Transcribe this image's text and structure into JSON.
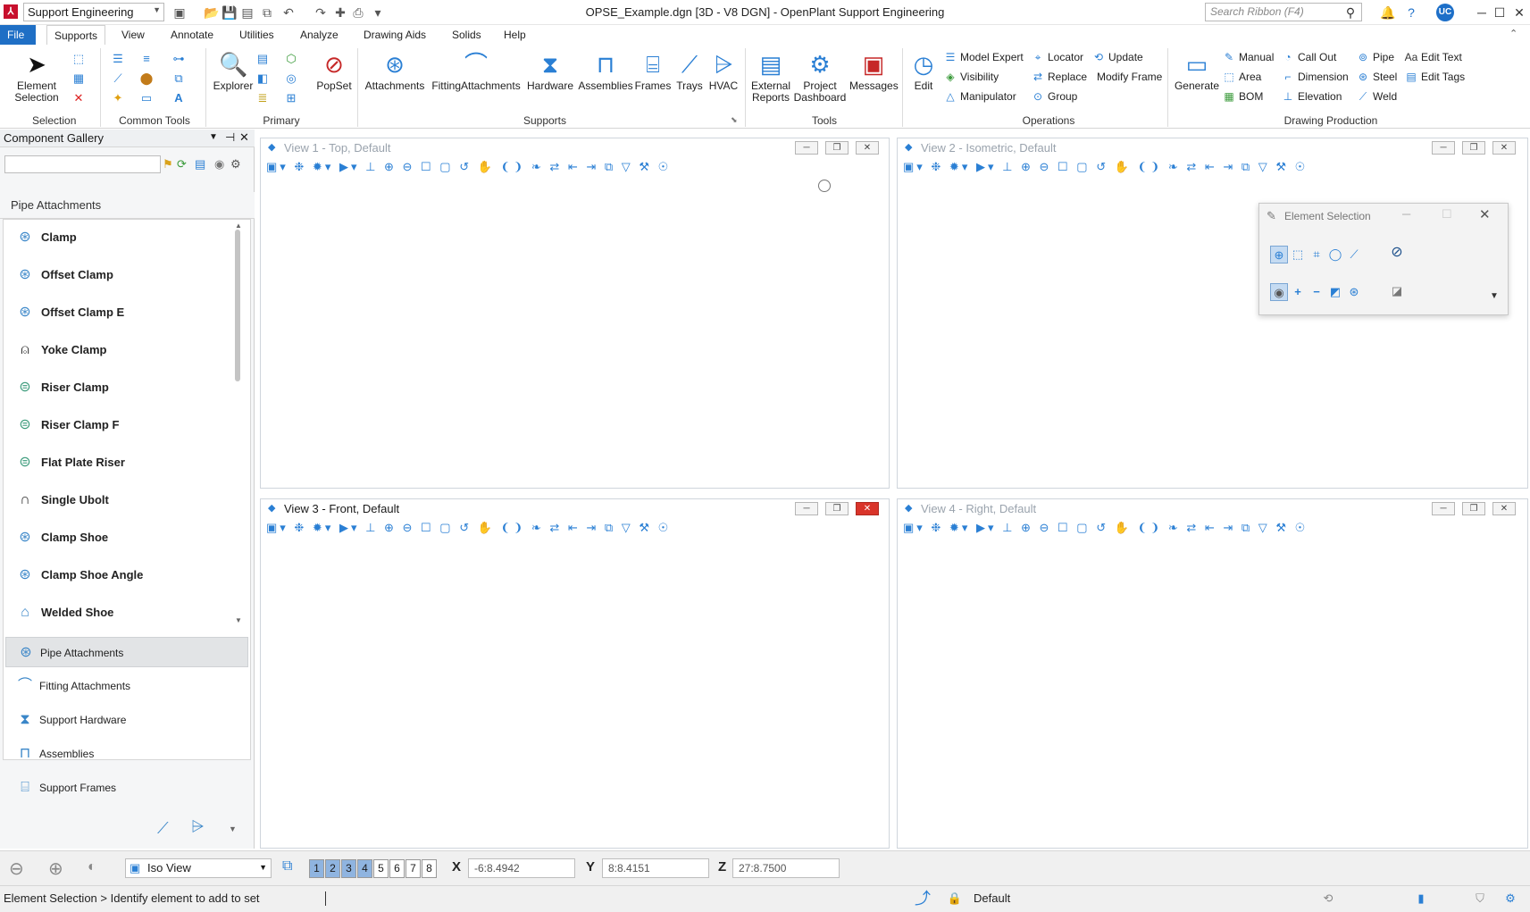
{
  "window": {
    "title": "OPSE_Example.dgn [3D - V8 DGN] - OpenPlant Support Engineering",
    "app_icon": "⅄",
    "workflow": "Support Engineering",
    "search_placeholder": "Search Ribbon (F4)",
    "user_initials": "UC"
  },
  "menu": {
    "tabs": [
      "File",
      "Supports",
      "View",
      "Annotate",
      "Utilities",
      "Analyze",
      "Drawing Aids",
      "Solids",
      "Help"
    ],
    "active_tab": "Supports"
  },
  "ribbon": {
    "groups": {
      "selection": "Selection",
      "common_tools": "Common Tools",
      "primary": "Primary",
      "supports": "Supports",
      "tools": "Tools",
      "operations": "Operations",
      "drawing_production": "Drawing Production"
    },
    "element_selection": "Element\nSelection",
    "element_selection_l1": "Element",
    "element_selection_l2": "Selection",
    "explorer": "Explorer",
    "popset": "PopSet",
    "attachments": "Attachments",
    "fitting_attachments": "FittingAttachments",
    "hardware": "Hardware",
    "assemblies": "Assemblies",
    "frames": "Frames",
    "trays": "Trays",
    "hvac": "HVAC",
    "external_reports_l1": "External",
    "external_reports_l2": "Reports",
    "project_dashboard_l1": "Project",
    "project_dashboard_l2": "Dashboard",
    "messages": "Messages",
    "edit": "Edit",
    "model_expert": "Model Expert",
    "visibility": "Visibility",
    "manipulator": "Manipulator",
    "locator": "Locator",
    "replace": "Replace",
    "group": "Group",
    "update": "Update",
    "modify_frame": "Modify Frame",
    "generate": "Generate",
    "manual": "Manual",
    "area": "Area",
    "bom": "BOM",
    "call_out": "Call Out",
    "dimension": "Dimension",
    "elevation": "Elevation",
    "pipe": "Pipe",
    "steel": "Steel",
    "weld": "Weld",
    "edit_text": "Edit Text",
    "edit_tags": "Edit Tags"
  },
  "gallery": {
    "title": "Component Gallery",
    "category": "Pipe Attachments",
    "items": [
      {
        "label": "Clamp",
        "icon": "clamp-icon"
      },
      {
        "label": "Offset Clamp",
        "icon": "offset-clamp-icon"
      },
      {
        "label": "Offset Clamp E",
        "icon": "offset-clamp-e-icon"
      },
      {
        "label": "Yoke Clamp",
        "icon": "yoke-clamp-icon"
      },
      {
        "label": "Riser Clamp",
        "icon": "riser-clamp-icon"
      },
      {
        "label": "Riser Clamp F",
        "icon": "riser-clamp-f-icon"
      },
      {
        "label": "Flat Plate Riser",
        "icon": "flat-plate-riser-icon"
      },
      {
        "label": "Single Ubolt",
        "icon": "ubolt-icon"
      },
      {
        "label": "Clamp Shoe",
        "icon": "clamp-shoe-icon"
      },
      {
        "label": "Clamp Shoe Angle",
        "icon": "clamp-shoe-angle-icon"
      },
      {
        "label": "Welded Shoe",
        "icon": "welded-shoe-icon"
      }
    ],
    "categories": [
      {
        "label": "Pipe Attachments",
        "selected": true
      },
      {
        "label": "Fitting Attachments",
        "selected": false
      },
      {
        "label": "Support Hardware",
        "selected": false
      },
      {
        "label": "Assemblies",
        "selected": false
      },
      {
        "label": "Support Frames",
        "selected": false
      }
    ]
  },
  "views": {
    "v1": "View 1 - Top, Default",
    "v2": "View 2 - Isometric, Default",
    "v3": "View 3 - Front, Default",
    "v4": "View 4 - Right, Default",
    "toolbar_glyphs": "▣▾ ❉ ✹▾ ▶▾ ⊥ ⊕ ⊖ ☐ ▢ ↺ ✋ ❨❩ ❧ ⇄ ⇤ ⇥ ⧉ ▽ ⚒ ☉"
  },
  "element_selection": {
    "title": "Element Selection"
  },
  "status": {
    "view_mode": "Iso View",
    "view_numbers": [
      "1",
      "2",
      "3",
      "4",
      "5",
      "6",
      "7",
      "8"
    ],
    "x_label": "X",
    "x_value": "-6:8.4942",
    "y_label": "Y",
    "y_value": "8:8.4151",
    "z_label": "Z",
    "z_value": "27:8.7500",
    "message": "Element Selection > Identify element to add to set",
    "level": "Default"
  }
}
